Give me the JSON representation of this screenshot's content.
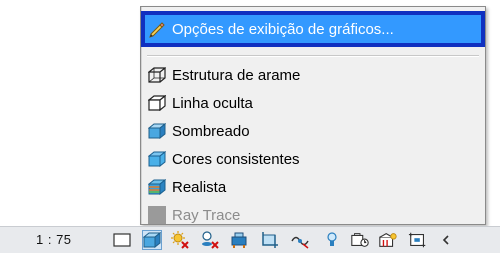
{
  "menu": {
    "items": [
      {
        "label": "Opções de exibição de gráficos...",
        "icon": "pencil-icon"
      },
      {
        "label": "Estrutura de arame",
        "icon": "wireframe-cube-icon"
      },
      {
        "label": "Linha oculta",
        "icon": "hidden-line-cube-icon"
      },
      {
        "label": "Sombreado",
        "icon": "shaded-cube-icon"
      },
      {
        "label": "Cores consistentes",
        "icon": "consistent-colors-cube-icon"
      },
      {
        "label": "Realista",
        "icon": "realistic-cube-icon"
      },
      {
        "label": "Ray Trace",
        "icon": "ray-trace-icon"
      }
    ],
    "highlight_color": "#3399ff",
    "highlight_border_color": "#1030c0"
  },
  "statusbar": {
    "scale": "1 : 75",
    "tools": [
      "detail-level-icon",
      "visual-style-cube-icon",
      "sun-path-icon",
      "shadows-icon",
      "render-icon",
      "crop-view-icon",
      "show-crop-icon",
      "temporary-hide-icon",
      "reveal-hidden-icon",
      "analytical-model-icon",
      "highlight-displacement-icon",
      "constraints-icon",
      "collapse-arrow-icon"
    ]
  }
}
